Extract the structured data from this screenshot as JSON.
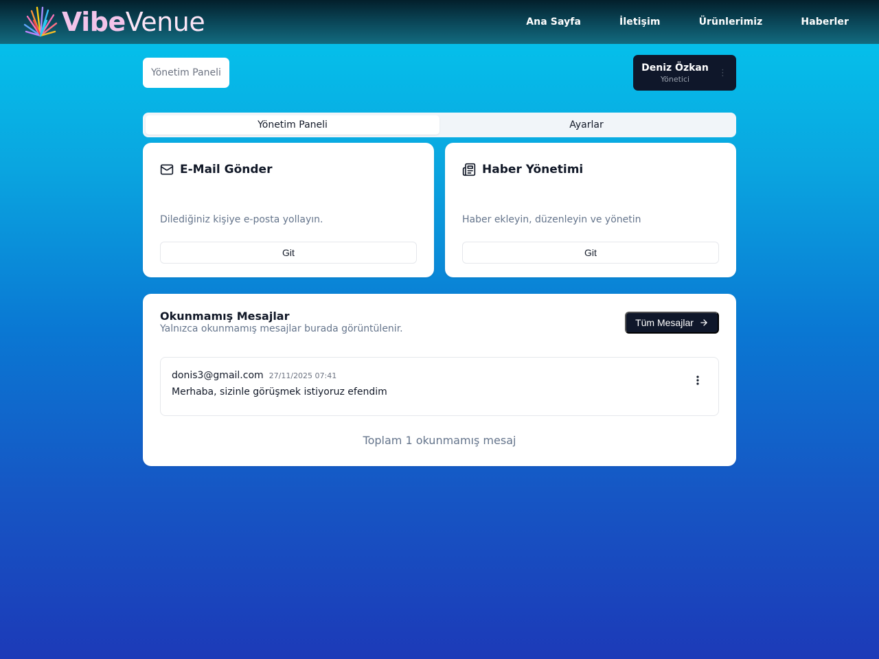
{
  "app": {
    "logo_vibe": "Vibe",
    "logo_venue": "Venue"
  },
  "nav": {
    "items": [
      "Ana Sayfa",
      "İletişim",
      "Ürünlerimiz",
      "Haberler"
    ]
  },
  "breadcrumb": "Yönetim Paneli",
  "user": {
    "name": "Deniz Özkan",
    "role": "Yönetici"
  },
  "tabs": [
    {
      "label": "Yönetim Paneli",
      "active": true
    },
    {
      "label": "Ayarlar",
      "active": false
    }
  ],
  "cards": [
    {
      "icon": "mail-icon",
      "title": "E-Mail Gönder",
      "description": "Dilediğiniz kişiye e-posta yollayın.",
      "button": "Git"
    },
    {
      "icon": "newspaper-icon",
      "title": "Haber Yönetimi",
      "description": "Haber ekleyin, düzenleyin ve yönetin",
      "button": "Git"
    }
  ],
  "messages": {
    "title": "Okunmamış Mesajlar",
    "subtitle": "Yalnızca okunmamış mesajlar burada görüntülenir.",
    "all_button": "Tüm Mesajlar",
    "items": [
      {
        "email": "donis3@gmail.com",
        "date": "27/11/2025 07:41",
        "body": "Merhaba, sizinle görüşmek istiyoruz efendim"
      }
    ],
    "total": "Toplam 1 okunmamış mesaj"
  },
  "colors": {
    "primary_dark": "#0f172a",
    "logo_accent": "#f2c4ea",
    "muted_text": "#64748b"
  }
}
